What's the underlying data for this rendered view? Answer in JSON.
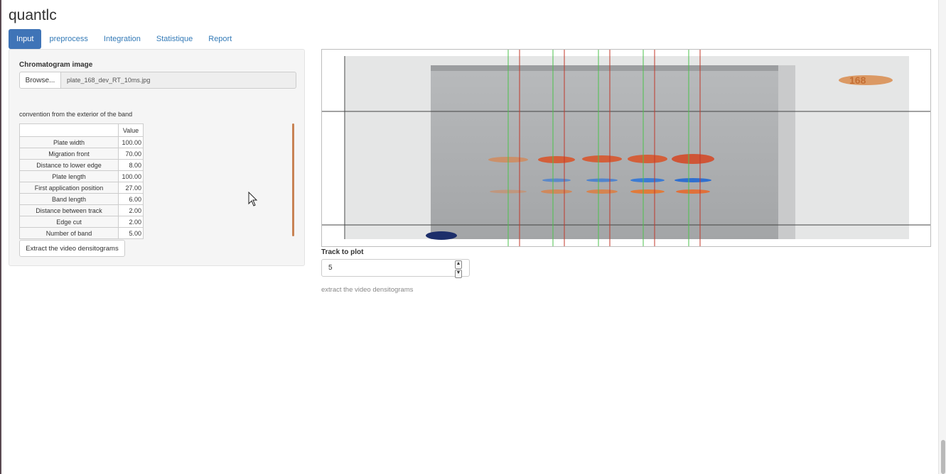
{
  "app": {
    "title": "quantlc"
  },
  "tabs": [
    {
      "label": "Input",
      "active": true
    },
    {
      "label": "preprocess",
      "active": false
    },
    {
      "label": "Integration",
      "active": false
    },
    {
      "label": "Statistique",
      "active": false
    },
    {
      "label": "Report",
      "active": false
    }
  ],
  "sidebar": {
    "image_label": "Chromatogram image",
    "browse_label": "Browse...",
    "file_name": "plate_168_dev_RT_10ms.jpg",
    "convention_text": "convention from the exterior of the band",
    "table": {
      "column_header": "Value",
      "rows": [
        {
          "name": "Plate width",
          "value": "100.00"
        },
        {
          "name": "Migration front",
          "value": "70.00"
        },
        {
          "name": "Distance to lower edge",
          "value": "8.00"
        },
        {
          "name": "Plate length",
          "value": "100.00"
        },
        {
          "name": "First application position",
          "value": "27.00"
        },
        {
          "name": "Band length",
          "value": "6.00"
        },
        {
          "name": "Distance between track",
          "value": "2.00"
        },
        {
          "name": "Edge cut",
          "value": "2.00"
        },
        {
          "name": "Number of band",
          "value": "5.00"
        }
      ]
    },
    "extract_button": "Extract the video densitograms"
  },
  "plot": {
    "plate_label": "168"
  },
  "track": {
    "label": "Track to plot",
    "value": "5"
  },
  "status_text": "extract the video densitograms",
  "colors": {
    "accent": "#3f74b7",
    "track_start_line": "#4cc24c",
    "track_end_line": "#c0392b",
    "band_orange": "#e07b3a",
    "band_blue": "#3b7bd4"
  }
}
